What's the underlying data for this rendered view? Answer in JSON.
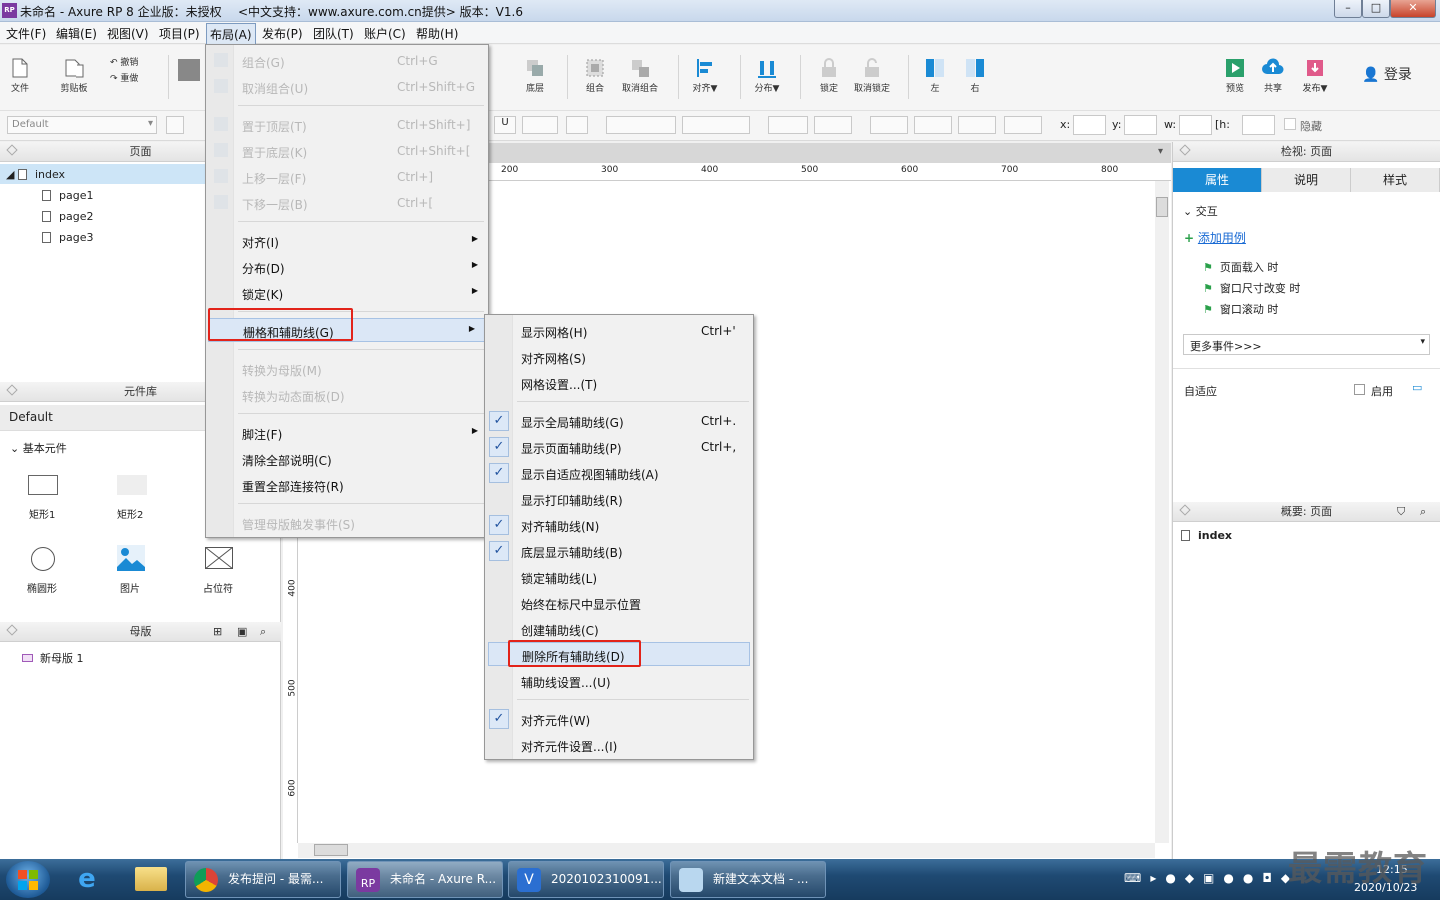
{
  "titlebar": {
    "title": "未命名 - Axure RP 8 企业版：未授权",
    "support": "<中文支持：www.axure.com.cn提供> 版本：V1.6",
    "app_icon": "RP"
  },
  "menubar": [
    "文件(F)",
    "编辑(E)",
    "视图(V)",
    "项目(P)",
    "布局(A)",
    "发布(P)",
    "团队(T)",
    "账户(C)",
    "帮助(H)"
  ],
  "toolbar": {
    "file": "文件",
    "clipboard": "剪贴板",
    "undo": "撤销",
    "redo": "重做",
    "bottom_layer": "底层",
    "group": "组合",
    "ungroup": "取消组合",
    "align": "对齐▼",
    "distribute": "分布▼",
    "lock": "锁定",
    "unlock": "取消锁定",
    "left": "左",
    "right": "右",
    "preview": "预览",
    "share": "共享",
    "publish": "发布▼",
    "login": "登录"
  },
  "toolbar2": {
    "style_select": "Default",
    "x_label": "x:",
    "y_label": "y:",
    "w_label": "w:",
    "h_label": "h:",
    "hidden": "隐藏"
  },
  "pages_panel": {
    "title": "页面",
    "root": "index",
    "children": [
      "page1",
      "page2",
      "page3"
    ]
  },
  "library_panel": {
    "title": "元件库",
    "select": "Default",
    "section": "基本元件",
    "widgets": [
      "矩形1",
      "矩形2",
      "椭圆形",
      "图片",
      "占位符"
    ]
  },
  "masters_panel": {
    "title": "母版",
    "items": [
      "新母版 1"
    ]
  },
  "ruler": {
    "top": [
      "200",
      "300",
      "400",
      "500",
      "600",
      "700",
      "800"
    ],
    "left": [
      "400",
      "500",
      "600"
    ]
  },
  "layout_menu": {
    "items": [
      {
        "label": "组合(G)",
        "shortcut": "Ctrl+G",
        "disabled": true
      },
      {
        "label": "取消组合(U)",
        "shortcut": "Ctrl+Shift+G",
        "disabled": true
      },
      {
        "label": "置于顶层(T)",
        "shortcut": "Ctrl+Shift+]",
        "disabled": true
      },
      {
        "label": "置于底层(K)",
        "shortcut": "Ctrl+Shift+[",
        "disabled": true
      },
      {
        "label": "上移一层(F)",
        "shortcut": "Ctrl+]",
        "disabled": true
      },
      {
        "label": "下移一层(B)",
        "shortcut": "Ctrl+[",
        "disabled": true
      },
      {
        "label": "对齐(I)"
      },
      {
        "label": "分布(D)"
      },
      {
        "label": "锁定(K)"
      },
      {
        "label": "栅格和辅助线(G)"
      },
      {
        "label": "转换为母版(M)",
        "disabled": true
      },
      {
        "label": "转换为动态面板(D)",
        "disabled": true
      },
      {
        "label": "脚注(F)"
      },
      {
        "label": "清除全部说明(C)"
      },
      {
        "label": "重置全部连接符(R)"
      },
      {
        "label": "管理母版触发事件(S)",
        "disabled": true
      }
    ]
  },
  "grid_submenu": {
    "items": [
      {
        "label": "显示网格(H)",
        "shortcut": "Ctrl+'"
      },
      {
        "label": "对齐网格(S)"
      },
      {
        "label": "网格设置...(T)"
      },
      {
        "label": "显示全局辅助线(G)",
        "shortcut": "Ctrl+.",
        "checked": true
      },
      {
        "label": "显示页面辅助线(P)",
        "shortcut": "Ctrl+,",
        "checked": true
      },
      {
        "label": "显示自适应视图辅助线(A)",
        "checked": true
      },
      {
        "label": "显示打印辅助线(R)"
      },
      {
        "label": "对齐辅助线(N)",
        "checked": true
      },
      {
        "label": "底层显示辅助线(B)",
        "checked": true
      },
      {
        "label": "锁定辅助线(L)"
      },
      {
        "label": "始终在标尺中显示位置"
      },
      {
        "label": "创建辅助线(C)"
      },
      {
        "label": "删除所有辅助线(D)"
      },
      {
        "label": "辅助线设置...(U)"
      },
      {
        "label": "对齐元件(W)",
        "checked": true
      },
      {
        "label": "对齐元件设置...(I)"
      }
    ]
  },
  "inspector": {
    "title": "检视: 页面",
    "tabs": [
      "属性",
      "说明",
      "样式"
    ],
    "section": "交互",
    "add_case": "添加用例",
    "events": [
      "页面载入 时",
      "窗口尺寸改变 时",
      "窗口滚动 时"
    ],
    "more_events": "更多事件>>>",
    "adaptive": "自适应",
    "enable": "启用"
  },
  "outline_panel": {
    "title": "概要: 页面",
    "item": "index"
  },
  "taskbar": {
    "tasks": [
      "发布提问 - 最需...",
      "未命名 - Axure R...",
      "2020102310091...",
      "新建文本文档 - ..."
    ],
    "time": "12:15",
    "date": "2020/10/23",
    "watermark": "最需教育"
  },
  "colors": {
    "accent_blue": "#1a8ad4",
    "highlight_red": "#e2231a",
    "axure_purple": "#7b3aa0"
  }
}
